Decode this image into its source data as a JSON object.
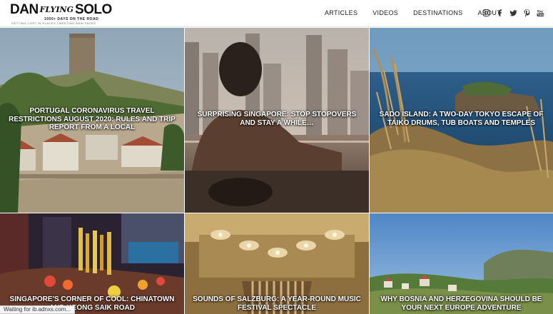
{
  "logo": {
    "dan": "DAN",
    "flying": "FLYING",
    "solo": "SOLO",
    "tagline_1": "1000+ DAYS ON THE ROAD",
    "tagline_2": "GETTING LOST IN PLACES | MEETING NEW FACES"
  },
  "nav": {
    "items": [
      {
        "label": "ARTICLES"
      },
      {
        "label": "VIDEOS"
      },
      {
        "label": "DESTINATIONS"
      },
      {
        "label": "ABOUT"
      }
    ]
  },
  "social": [
    "instagram-icon",
    "facebook-icon",
    "twitter-icon",
    "pinterest-icon",
    "youtube-icon"
  ],
  "tiles": [
    {
      "title": "PORTUGAL CORONAVIRUS TRAVEL RESTRICTIONS AUGUST 2020: RULES AND TRIP REPORT FROM A LOCAL"
    },
    {
      "title": "SURPRISING SINGAPORE: STOP STOPOVERS AND STAY A WHILE…"
    },
    {
      "title": "SADO ISLAND: A TWO-DAY TOKYO ESCAPE OF TAIKO DRUMS, TUB BOATS AND TEMPLES"
    },
    {
      "title": "SINGAPORE'S CORNER OF COOL: CHINATOWN AND KEONG SAIK ROAD"
    },
    {
      "title": "SOUNDS OF SALZBURG: A YEAR-ROUND MUSIC FESTIVAL SPECTACLE"
    },
    {
      "title": "WHY BOSNIA AND HERZEGOVINA SHOULD BE YOUR NEXT EUROPE ADVENTURE"
    }
  ],
  "status_bar": {
    "text": "Waiting for ib.adnxs.com..."
  },
  "colors": {
    "text_dark": "#222222",
    "header_bg": "#ffffff",
    "tile_title": "#ffffff"
  }
}
